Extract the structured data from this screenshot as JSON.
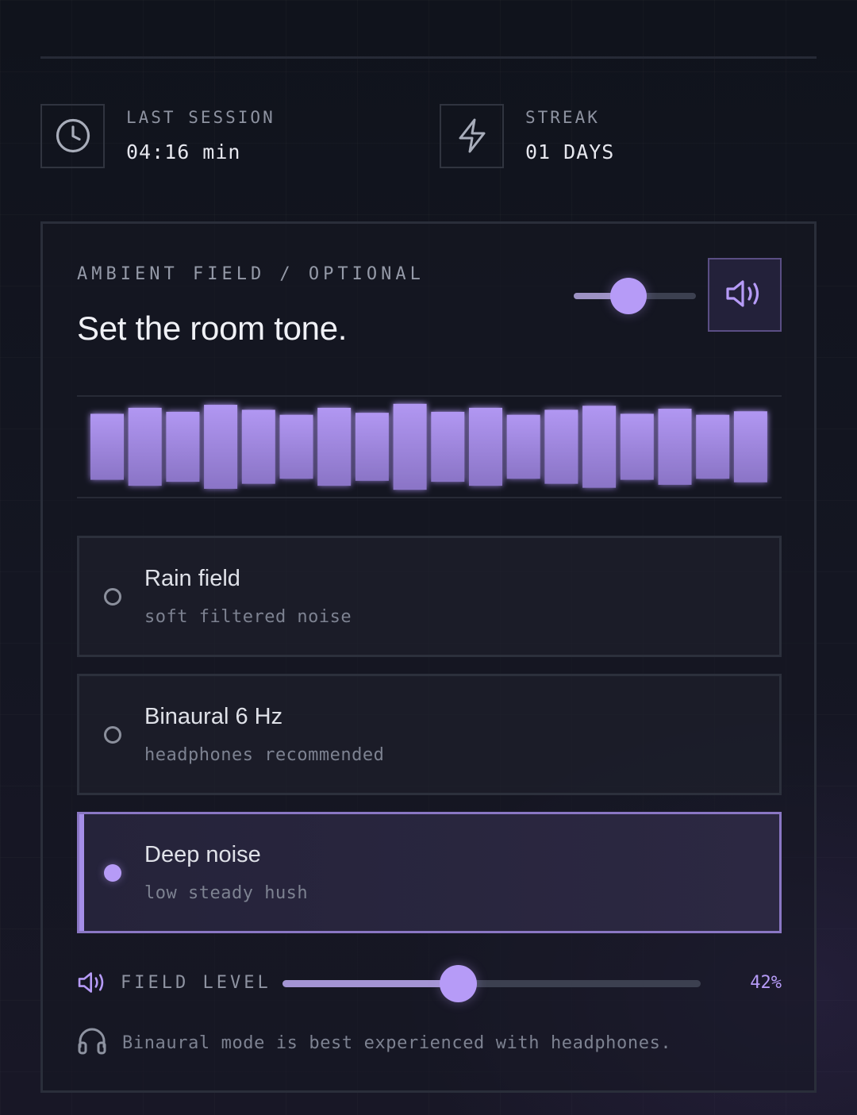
{
  "stats": {
    "last_session": {
      "label": "LAST SESSION",
      "value": "04:16 min",
      "icon": "clock-icon"
    },
    "streak": {
      "label": "STREAK",
      "value": "01 DAYS",
      "icon": "lightning-icon"
    }
  },
  "ambient": {
    "eyebrow": "AMBIENT FIELD / OPTIONAL",
    "title": "Set the room tone.",
    "mini_volume_level": 0.45,
    "speaker_icon": "speaker-icon",
    "visualizer_bars": [
      0.66,
      0.78,
      0.7,
      0.84,
      0.74,
      0.64,
      0.78,
      0.68,
      0.86,
      0.7,
      0.78,
      0.64,
      0.74,
      0.82,
      0.66,
      0.76,
      0.64,
      0.71
    ],
    "options": [
      {
        "title": "Rain field",
        "subtitle": "soft filtered noise",
        "selected": false
      },
      {
        "title": "Binaural 6 Hz",
        "subtitle": "headphones recommended",
        "selected": false
      },
      {
        "title": "Deep noise",
        "subtitle": "low steady hush",
        "selected": true
      }
    ],
    "field_level": {
      "label": "FIELD LEVEL",
      "value": "42%",
      "fraction": 0.42
    },
    "hint": "Binaural mode is best experienced with headphones."
  },
  "colors": {
    "accent": "#b69bf7",
    "background": "#12141d",
    "border": "#2a2e3a"
  }
}
